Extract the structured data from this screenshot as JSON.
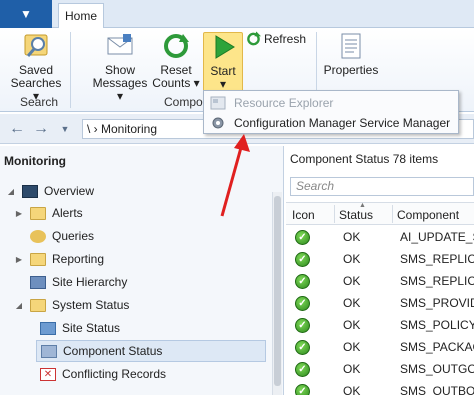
{
  "ribbon_tabs": {
    "file_tab": "▼",
    "home_tab": "Home"
  },
  "ribbon": {
    "saved_searches": "Saved\nSearches ▾",
    "saved_searches_l1": "Saved",
    "saved_searches_l2": "Searches ▾",
    "search_group": "Search",
    "show_messages_l1": "Show",
    "show_messages_l2": "Messages ▾",
    "reset_counts_l1": "Reset",
    "reset_counts_l2": "Counts ▾",
    "start_l1": "Start",
    "start_l2": "▾",
    "refresh": "Refresh",
    "properties": "Properties",
    "component_group": "Compo"
  },
  "dropdown": {
    "item1": "Resource Explorer",
    "item2": "Configuration Manager Service Manager"
  },
  "address": {
    "back_icon": "arrow-left",
    "forward_icon": "arrow-right",
    "path": "\\   ›   Monitoring"
  },
  "nav": {
    "title": "Monitoring",
    "items": [
      {
        "label": "Overview"
      },
      {
        "label": "Alerts"
      },
      {
        "label": "Queries"
      },
      {
        "label": "Reporting"
      },
      {
        "label": "Site Hierarchy"
      },
      {
        "label": "System Status"
      },
      {
        "label": "Site Status"
      },
      {
        "label": "Component Status"
      },
      {
        "label": "Conflicting Records"
      }
    ]
  },
  "component_status": {
    "title": "Component Status 78 items",
    "search_placeholder": "Search",
    "headers": {
      "icon": "Icon",
      "status": "Status",
      "component": "Component"
    },
    "rows": [
      {
        "status": "OK",
        "component": "AI_UPDATE_SE"
      },
      {
        "status": "OK",
        "component": "SMS_REPLICAT"
      },
      {
        "status": "OK",
        "component": "SMS_REPLICAT"
      },
      {
        "status": "OK",
        "component": "SMS_PROVIDE"
      },
      {
        "status": "OK",
        "component": "SMS_POLICY_F"
      },
      {
        "status": "OK",
        "component": "SMS_PACKAGE"
      },
      {
        "status": "OK",
        "component": "SMS_OUTGOII"
      },
      {
        "status": "OK",
        "component": "SMS_OUTBOX"
      }
    ]
  },
  "colors": {
    "accent": "#1f5fa8",
    "ok_green": "#2e8a1e",
    "arrow_red": "#e02020"
  }
}
